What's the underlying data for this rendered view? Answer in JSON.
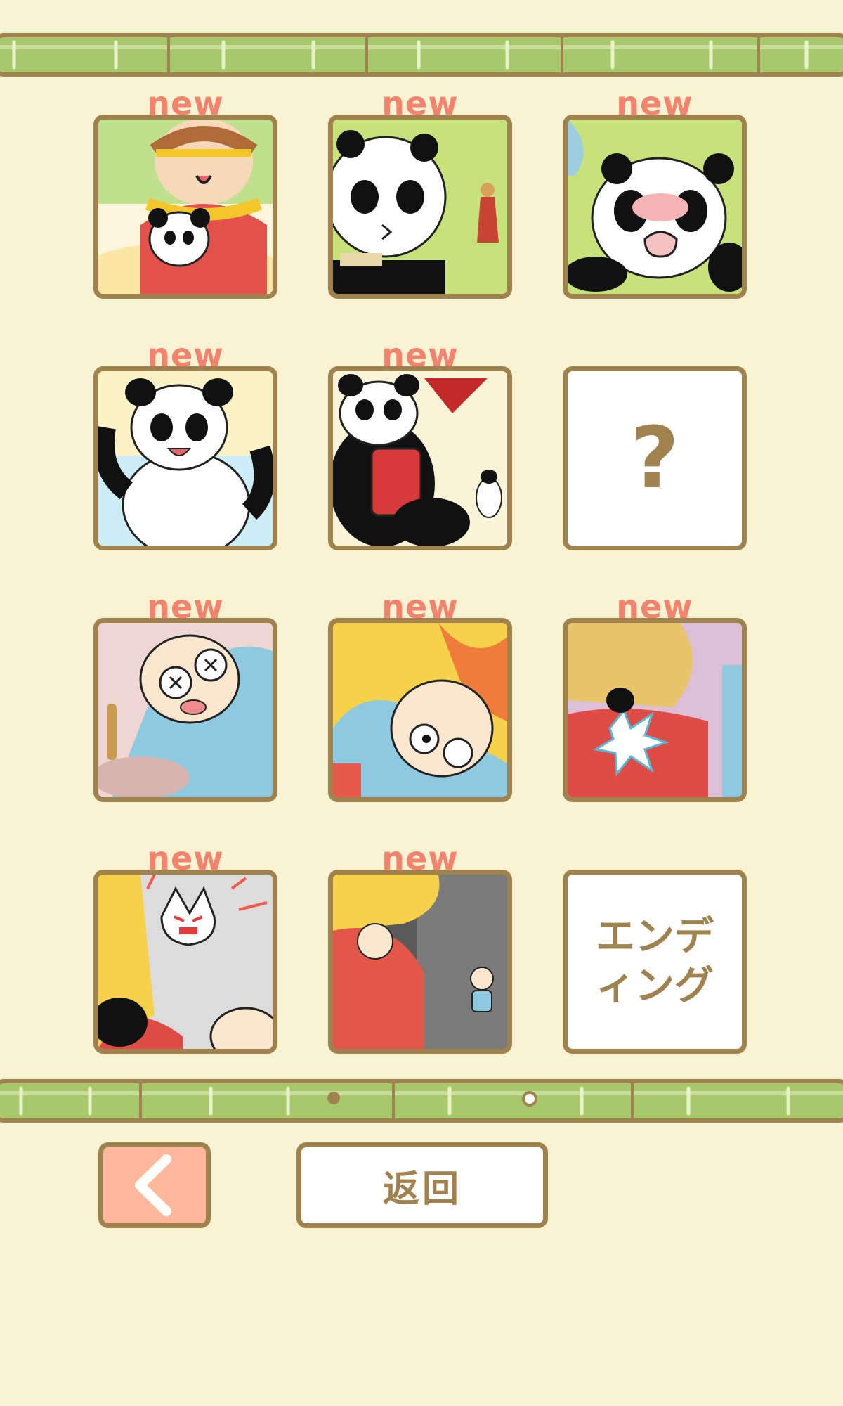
{
  "gallery": {
    "new_label": "new",
    "tiles": [
      {
        "id": 1,
        "new": true,
        "state": "unlocked",
        "scene": "monkey-king-holding-panda"
      },
      {
        "id": 2,
        "new": true,
        "state": "unlocked",
        "scene": "dazed-panda"
      },
      {
        "id": 3,
        "new": true,
        "state": "unlocked",
        "scene": "crying-panda"
      },
      {
        "id": 4,
        "new": true,
        "state": "unlocked",
        "scene": "happy-panda"
      },
      {
        "id": 5,
        "new": true,
        "state": "unlocked",
        "scene": "panda-with-barrel"
      },
      {
        "id": 6,
        "new": false,
        "state": "locked",
        "label": "?"
      },
      {
        "id": 7,
        "new": true,
        "state": "unlocked",
        "scene": "old-man-knocked-out"
      },
      {
        "id": 8,
        "new": true,
        "state": "unlocked",
        "scene": "old-man-fire"
      },
      {
        "id": 9,
        "new": true,
        "state": "unlocked",
        "scene": "man-hit"
      },
      {
        "id": 10,
        "new": true,
        "state": "unlocked",
        "scene": "angry-wolf"
      },
      {
        "id": 11,
        "new": true,
        "state": "unlocked",
        "scene": "falling-old-man"
      },
      {
        "id": 12,
        "new": false,
        "state": "ending",
        "label": "エンディング"
      }
    ]
  },
  "pagination": {
    "pages": 2,
    "current": 1
  },
  "controls": {
    "back_icon": "chevron-left-icon",
    "return_label": "返回"
  },
  "colors": {
    "background": "#f9f3d3",
    "frame": "#a0824e",
    "new_badge": "#f4836e",
    "back_button": "#ffb89a",
    "bamboo": "#a8c86c"
  }
}
